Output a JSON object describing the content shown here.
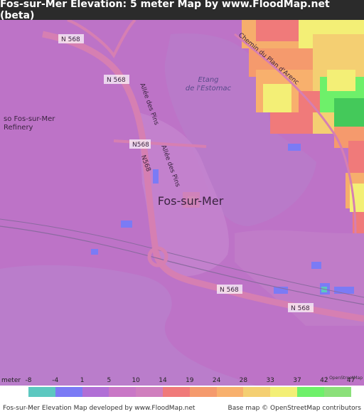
{
  "title": "Fos-sur-Mer Elevation: 5 meter Map by www.FloodMap.net (beta)",
  "map": {
    "place_labels": {
      "town": "Fos-sur-Mer",
      "refinery": "so Fos-sur-Mer\nRefinery",
      "etang": "Etang\nde l'Estomac"
    },
    "roads": {
      "n568_a": "N 568",
      "n568_b": "N 568",
      "n568_c": "N568",
      "n568_d": "N568",
      "n568_e": "N 568",
      "n568_f": "N 568",
      "allee1": "Allée des Pins",
      "allee2": "Allée des Pins",
      "chemin": "Chemin du Plan d'Arenc"
    },
    "colors": {
      "water": "#b97ac9",
      "land": "#be72c8",
      "town": "#c58fd0",
      "road": "#d67fb2"
    }
  },
  "legend": {
    "unit_label": "meter",
    "ticks": [
      "-8",
      "-4",
      "1",
      "5",
      "10",
      "14",
      "19",
      "24",
      "28",
      "33",
      "37",
      "42",
      "47"
    ],
    "colors": [
      "#5cc8c0",
      "#7b7bf5",
      "#b16fd6",
      "#c977c6",
      "#d07fbe",
      "#f07a7a",
      "#f59a6d",
      "#f8b06d",
      "#f4cf72",
      "#f3ef76",
      "#6ef06a",
      "#8be07a"
    ]
  },
  "footer": {
    "left": "Fos-sur-Mer Elevation Map developed by www.FloodMap.net",
    "right": "Base map © OpenStreetMap contributors"
  },
  "attribution_logo": "OpenStreetMap"
}
